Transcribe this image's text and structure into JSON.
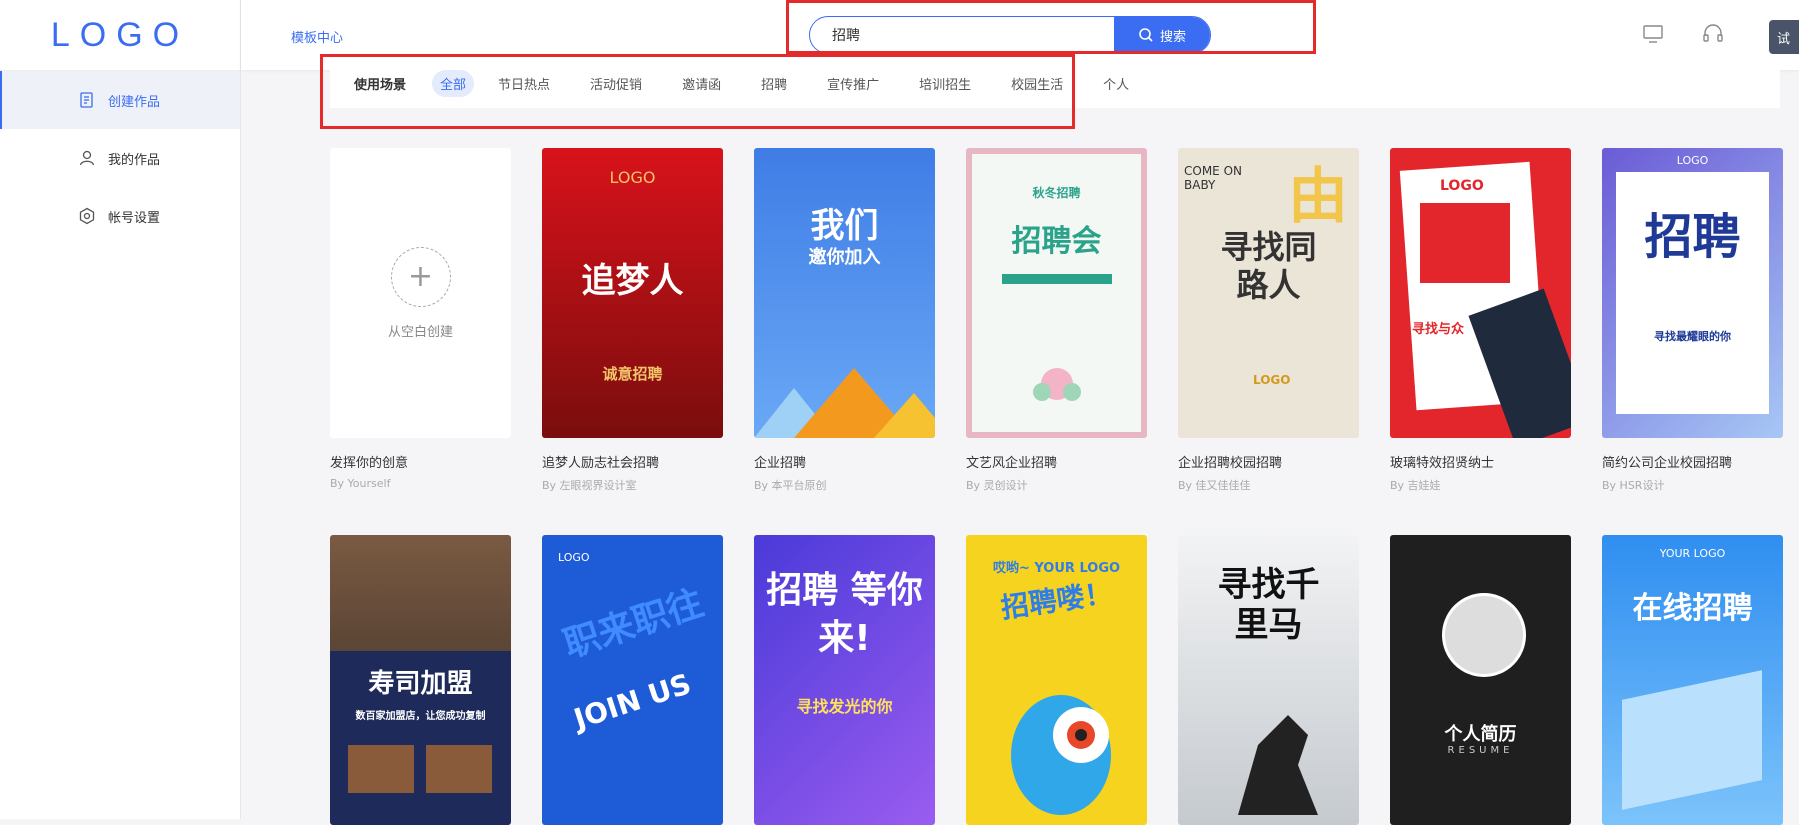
{
  "app": {
    "logo": "LOGO"
  },
  "sidebar": {
    "items": [
      {
        "label": "创建作品",
        "icon": "create-icon",
        "active": true
      },
      {
        "label": "我的作品",
        "icon": "user-icon",
        "active": false
      },
      {
        "label": "帐号设置",
        "icon": "settings-icon",
        "active": false
      }
    ]
  },
  "header": {
    "breadcrumb": "模板中心",
    "search": {
      "value": "招聘",
      "button_label": "搜索"
    },
    "trial_label": "试"
  },
  "filter": {
    "label": "使用场景",
    "chips": [
      "全部",
      "节日热点",
      "活动促销",
      "邀请函",
      "招聘",
      "宣传推广",
      "培训招生",
      "校园生活",
      "个人"
    ],
    "active_index": 0
  },
  "blank_card": {
    "label": "从空白创建",
    "title": "发挥你的创意",
    "author": "By Yourself"
  },
  "templates": [
    {
      "title": "追梦人励志社会招聘",
      "author": "By 左眼视界设计室",
      "poster_text": "追梦人",
      "poster_sub": "诚意招聘",
      "poster_logo": "LOGO",
      "bg": "#c0121a"
    },
    {
      "title": "企业招聘",
      "author": "By 本平台原创",
      "poster_text": "我们",
      "poster_sub": "邀你加入",
      "bg": "#4a86e8"
    },
    {
      "title": "文艺风企业招聘",
      "author": "By 灵创设计",
      "poster_text": "招聘会",
      "poster_sub": "秋冬招聘",
      "bg": "#f3f7f4"
    },
    {
      "title": "企业招聘校园招聘",
      "author": "By 佳又佳佳佳",
      "poster_text": "寻找同路人",
      "poster_sub": "COME ON BABY",
      "poster_logo": "LOGO",
      "bg": "#e9e3d6"
    },
    {
      "title": "玻璃特效招贤纳士",
      "author": "By 吉娃娃",
      "poster_text": "寻找与众",
      "poster_logo": "LOGO",
      "bg": "#d71f25"
    },
    {
      "title": "简约公司企业校园招聘",
      "author": "By HSR设计",
      "poster_text": "招聘",
      "poster_sub": "寻找最耀眼的你",
      "poster_logo": "LOGO",
      "bg": "#eef2fb"
    },
    {
      "title": "",
      "author": "",
      "poster_text": "寿司加盟",
      "poster_sub": "数百家加盟店，让您成功复制",
      "bg": "#1d2a5a"
    },
    {
      "title": "",
      "author": "",
      "poster_text": "职来职往",
      "poster_sub": "JOIN US",
      "poster_logo": "LOGO",
      "bg": "#1e5bd6"
    },
    {
      "title": "",
      "author": "",
      "poster_text": "招聘 等你来!",
      "poster_sub": "寻找发光的你",
      "bg": "#6a3be0"
    },
    {
      "title": "",
      "author": "",
      "poster_text": "招聘喽！",
      "poster_sub": "哎哟~ YOUR LOGO",
      "bg": "#f5d31e"
    },
    {
      "title": "",
      "author": "",
      "poster_text": "寻找千里马",
      "bg": "#dfe3e6"
    },
    {
      "title": "",
      "author": "",
      "poster_text": "个人简历",
      "poster_sub": "RESUME",
      "bg": "#1f1f1f"
    },
    {
      "title": "",
      "author": "",
      "poster_text": "在线招聘",
      "poster_sub": "YOUR LOGO",
      "bg": "#2f8ef0"
    }
  ],
  "colors": {
    "accent": "#3b6df2",
    "highlight_box": "#e42a2a"
  }
}
